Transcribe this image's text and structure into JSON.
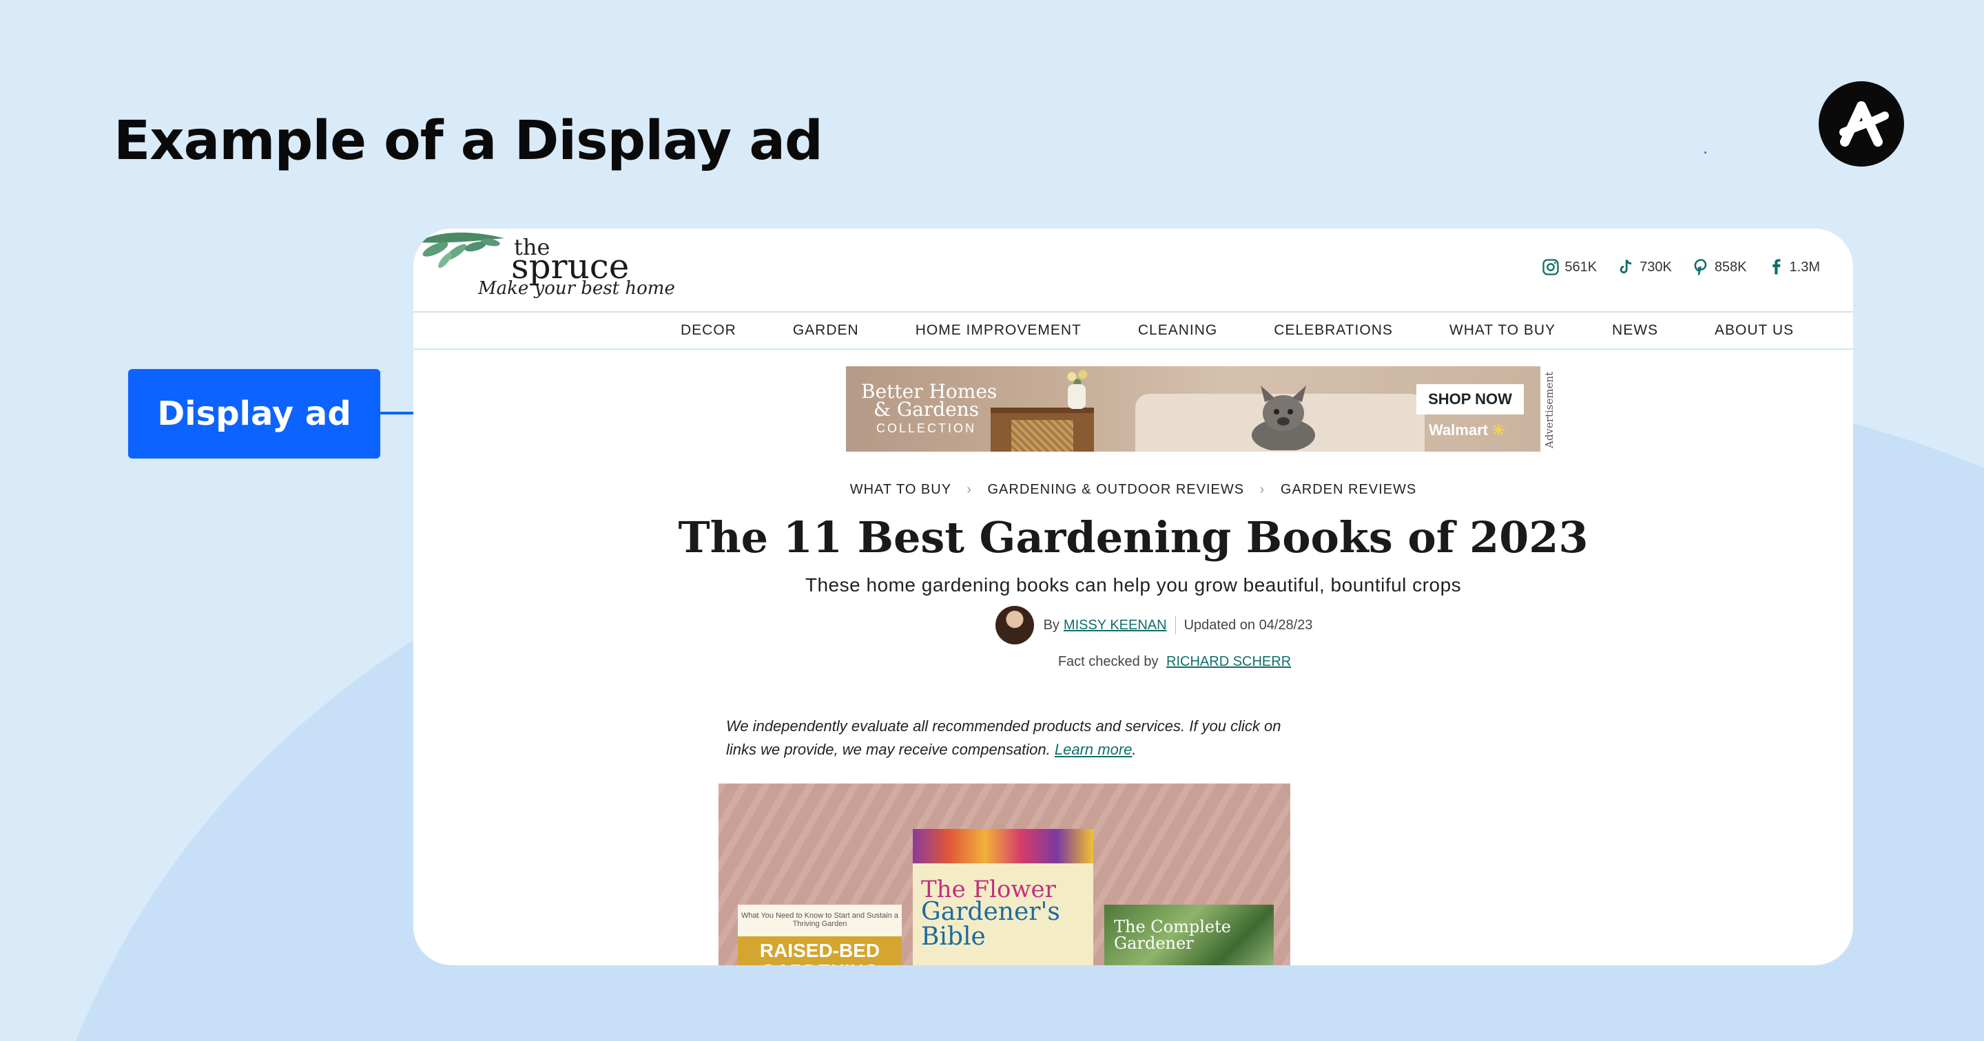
{
  "slide": {
    "title": "Example of a Display ad",
    "callout_label": "Display ad"
  },
  "site": {
    "logo": {
      "the": "the",
      "name": "spruce",
      "tagline": "Make your best home"
    },
    "social": [
      {
        "icon": "instagram-icon",
        "count": "561K"
      },
      {
        "icon": "tiktok-icon",
        "count": "730K"
      },
      {
        "icon": "pinterest-icon",
        "count": "858K"
      },
      {
        "icon": "facebook-icon",
        "count": "1.3M"
      }
    ],
    "nav": [
      "DECOR",
      "GARDEN",
      "HOME IMPROVEMENT",
      "CLEANING",
      "CELEBRATIONS",
      "WHAT TO BUY",
      "NEWS",
      "ABOUT US"
    ]
  },
  "ad": {
    "brand_line1": "Better Homes",
    "brand_line2": "& Gardens",
    "collection": "COLLECTION",
    "cta": "SHOP NOW",
    "retailer": "Walmart",
    "label": "Advertisement"
  },
  "article": {
    "breadcrumb": [
      "WHAT TO BUY",
      "GARDENING & OUTDOOR REVIEWS",
      "GARDEN REVIEWS"
    ],
    "headline": "The 11 Best Gardening Books of 2023",
    "subhead": "These home gardening books can help you grow beautiful, bountiful crops",
    "by": "By",
    "author": "MISSY KEENAN",
    "updated": "Updated on 04/28/23",
    "fact_checked_by": "Fact checked by",
    "fact_checker": "RICHARD SCHERR",
    "disclaimer": "We independently evaluate all recommended products and services. If you click on links we provide, we may receive compensation.",
    "learn_more": "Learn more",
    "books": {
      "book1_top": "What You Need to Know to Start and Sustain a Thriving Garden",
      "book1_title": "RAISED-BED GARDENING",
      "book2_line1": "The Flower",
      "book2_line2": "Gardener's",
      "book2_line3": "Bible",
      "book3_title": "The Complete Gardener"
    }
  },
  "colors": {
    "background": "#d9eaf9",
    "accent": "#0c63ff",
    "link": "#0f6e6a"
  }
}
